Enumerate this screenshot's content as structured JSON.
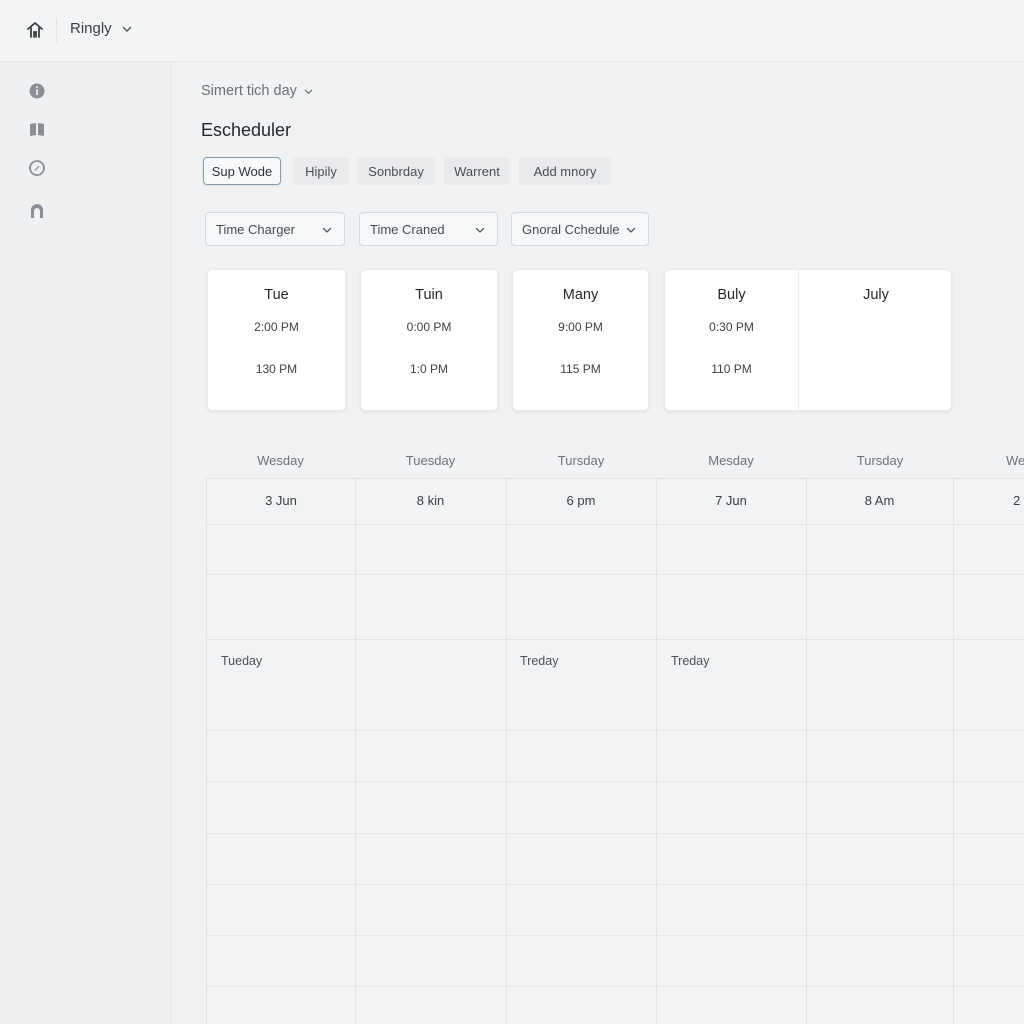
{
  "topbar": {
    "app_name": "Ringly"
  },
  "sidebar": {
    "icons": [
      "info-icon",
      "calendar-icon",
      "settings-icon",
      "bell-icon"
    ]
  },
  "main": {
    "view_select": "Simert tich day",
    "title": "Escheduler",
    "tabs": [
      "Sup Wode",
      "Hipily",
      "Sonbrday",
      "Warrent",
      "Add mnory"
    ],
    "active_tab": 0,
    "filters": [
      "Time Charger",
      "Time Craned",
      "Gnoral Cchedule"
    ]
  },
  "cards": [
    {
      "title": "Tue",
      "time1": "2:00 PM",
      "time2": "130 PM"
    },
    {
      "title": "Tuin",
      "time1": "0:00 PM",
      "time2": "1:0 PM"
    },
    {
      "title": "Many",
      "time1": "9:00 PM",
      "time2": "115 PM"
    },
    {
      "title": "Buly",
      "time1": "0:30 PM",
      "time2": "110 PM"
    },
    {
      "title": "July"
    }
  ],
  "grid": {
    "day_headers": [
      "Wesday",
      "Tuesday",
      "Tursday",
      "Mesday",
      "Tursday",
      "We"
    ],
    "dates": [
      "3 Jun",
      "8 kin",
      "6 pm",
      "7 Jun",
      "8 Am",
      "2"
    ],
    "events": [
      "Tueday",
      "Treday",
      "Treday"
    ]
  },
  "colors": {
    "accent": "#7e9fb3",
    "background": "#f1f2f3",
    "card": "#ffffff"
  }
}
